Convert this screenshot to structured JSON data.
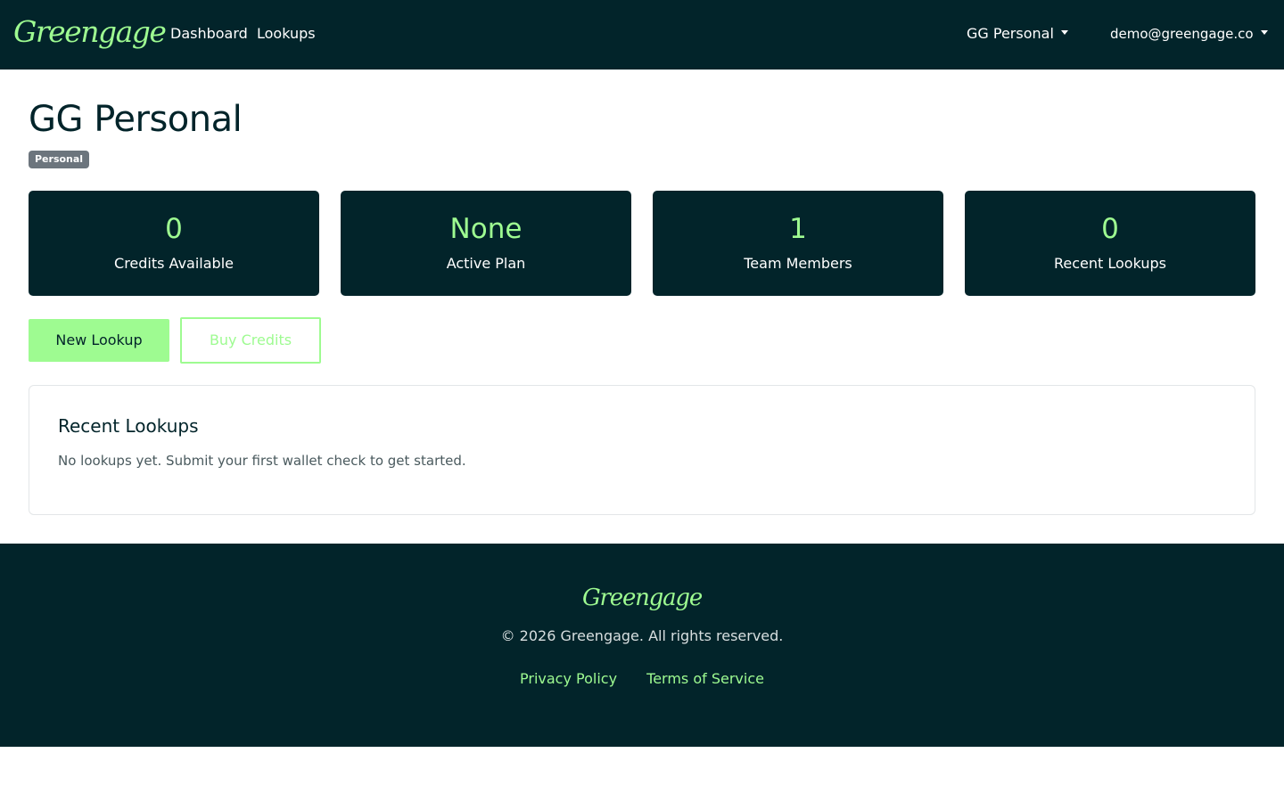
{
  "header": {
    "brand": "Greengage",
    "nav": {
      "dashboard": "Dashboard",
      "lookups": "Lookups"
    },
    "org_dropdown": "GG Personal",
    "user_dropdown": "demo@greengage.co"
  },
  "page": {
    "title": "GG Personal",
    "badge": "Personal"
  },
  "stats": [
    {
      "value": "0",
      "label": "Credits Available"
    },
    {
      "value": "None",
      "label": "Active Plan"
    },
    {
      "value": "1",
      "label": "Team Members"
    },
    {
      "value": "0",
      "label": "Recent Lookups"
    }
  ],
  "actions": {
    "new_lookup": "New Lookup",
    "buy_credits": "Buy Credits"
  },
  "recent": {
    "title": "Recent Lookups",
    "empty_text": "No lookups yet. Submit your first wallet check to get started."
  },
  "footer": {
    "brand": "Greengage",
    "copyright": "© 2026 Greengage. All rights reserved.",
    "privacy": "Privacy Policy",
    "terms": "Terms of Service"
  },
  "colors": {
    "dark": "#02242a",
    "accent": "#9efb91",
    "badge": "#6c757d"
  }
}
